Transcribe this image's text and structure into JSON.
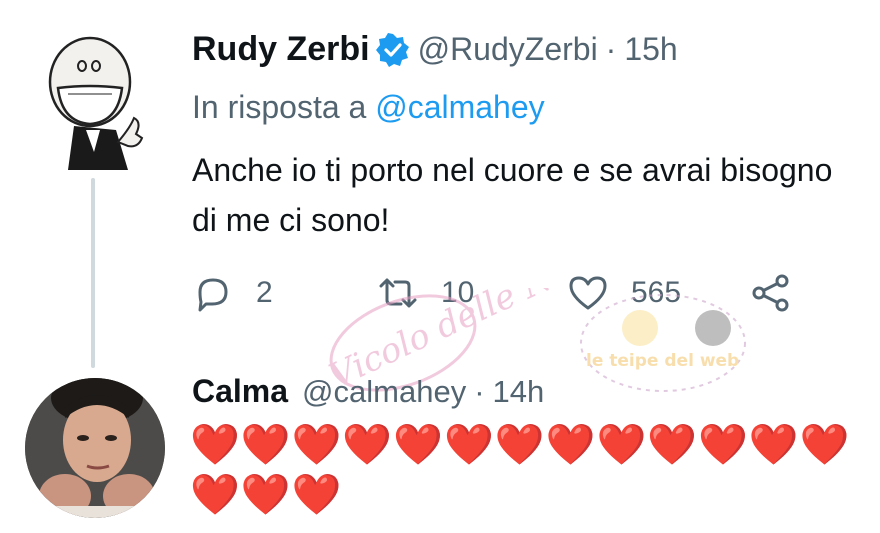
{
  "tweet": {
    "author_name": "Rudy Zerbi",
    "handle": "@RudyZerbi",
    "separator": "·",
    "time": "15h",
    "reply_prefix": "In risposta a",
    "reply_to": "@calmahey",
    "text": "Anche io ti porto nel cuore e se avrai bisogno di me ci sono!",
    "reply_count": "2",
    "retweet_count": "10",
    "like_count": "565",
    "verified": true
  },
  "reply": {
    "author_name": "Calma",
    "handle": "@calmahey",
    "separator": "·",
    "time": "14h",
    "text": "❤️❤️❤️❤️❤️❤️❤️❤️❤️❤️❤️❤️❤️❤️❤️❤️"
  },
  "watermark": {
    "left_text": "Vicolo delle News",
    "right_text": "le teipe del web"
  },
  "colors": {
    "verified": "#1d9bf0",
    "mention": "#1d9bf0",
    "muted": "#536471",
    "heart": "#d91a2a"
  }
}
